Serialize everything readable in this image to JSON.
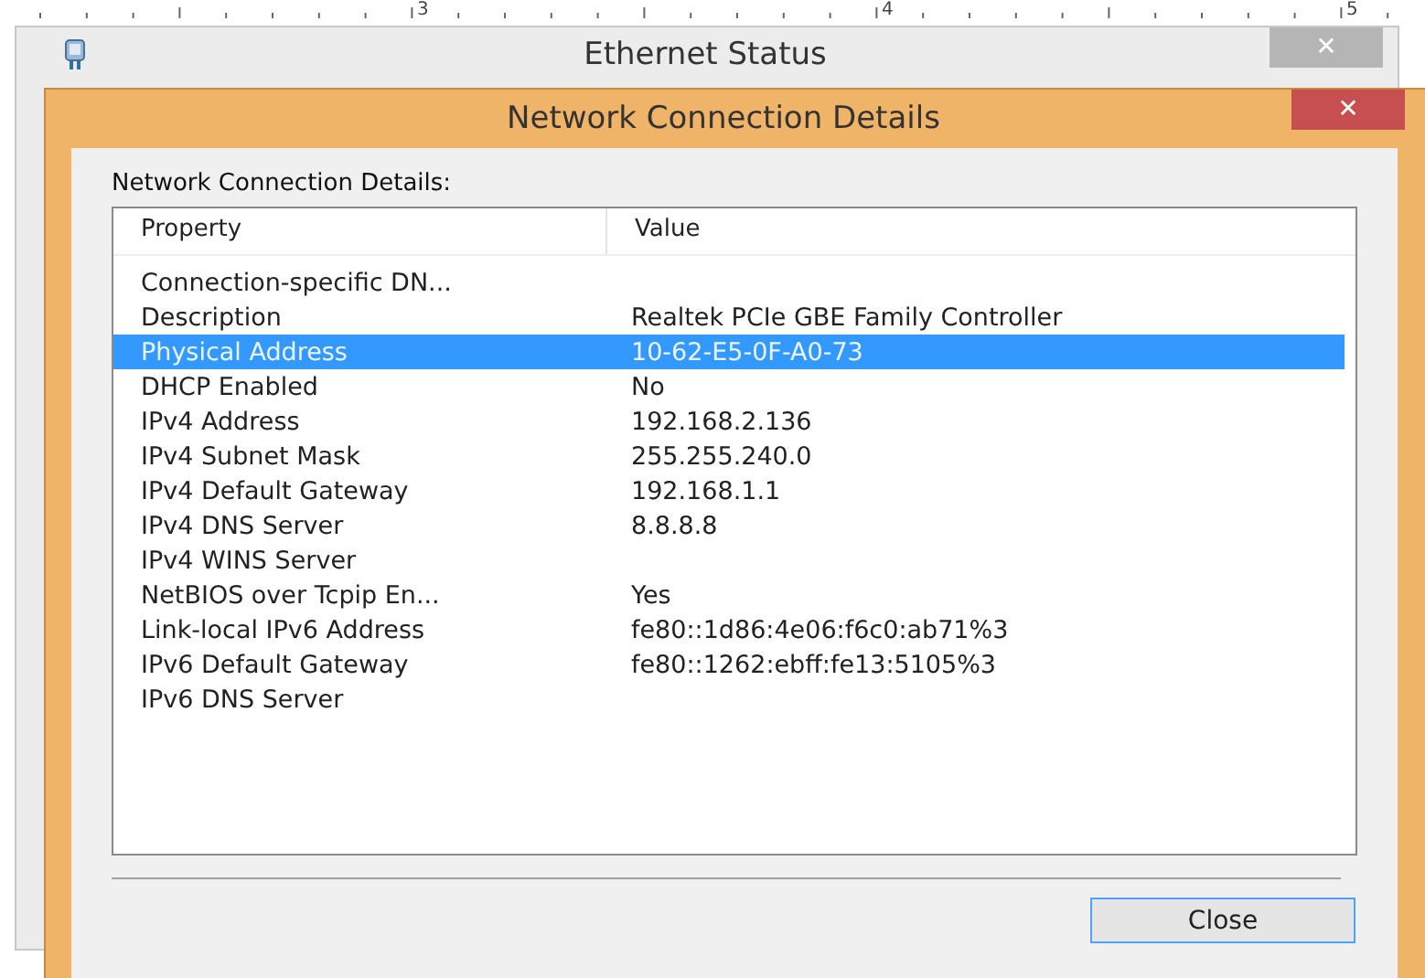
{
  "ruler": {
    "numbers": [
      "3",
      "4",
      "5"
    ]
  },
  "background_window": {
    "title": "Ethernet Status",
    "close": "✕"
  },
  "dialog": {
    "title": "Network Connection Details",
    "close": "✕",
    "label": "Network Connection Details:",
    "table": {
      "columns": [
        "Property",
        "Value"
      ],
      "rows": [
        {
          "property": "Connection-specific DN...",
          "value": "",
          "selected": false
        },
        {
          "property": "Description",
          "value": "Realtek PCIe GBE Family Controller",
          "selected": false
        },
        {
          "property": "Physical Address",
          "value": "10-62-E5-0F-A0-73",
          "selected": true
        },
        {
          "property": "DHCP Enabled",
          "value": "No",
          "selected": false
        },
        {
          "property": "IPv4 Address",
          "value": "192.168.2.136",
          "selected": false
        },
        {
          "property": "IPv4 Subnet Mask",
          "value": "255.255.240.0",
          "selected": false
        },
        {
          "property": "IPv4 Default Gateway",
          "value": "192.168.1.1",
          "selected": false
        },
        {
          "property": "IPv4 DNS Server",
          "value": "8.8.8.8",
          "selected": false
        },
        {
          "property": "IPv4 WINS Server",
          "value": "",
          "selected": false
        },
        {
          "property": "NetBIOS over Tcpip En...",
          "value": "Yes",
          "selected": false
        },
        {
          "property": "Link-local IPv6 Address",
          "value": "fe80::1d86:4e06:f6c0:ab71%3",
          "selected": false
        },
        {
          "property": "IPv6 Default Gateway",
          "value": "fe80::1262:ebff:fe13:5105%3",
          "selected": false
        },
        {
          "property": "IPv6 DNS Server",
          "value": "",
          "selected": false
        }
      ]
    },
    "button": "Close"
  }
}
